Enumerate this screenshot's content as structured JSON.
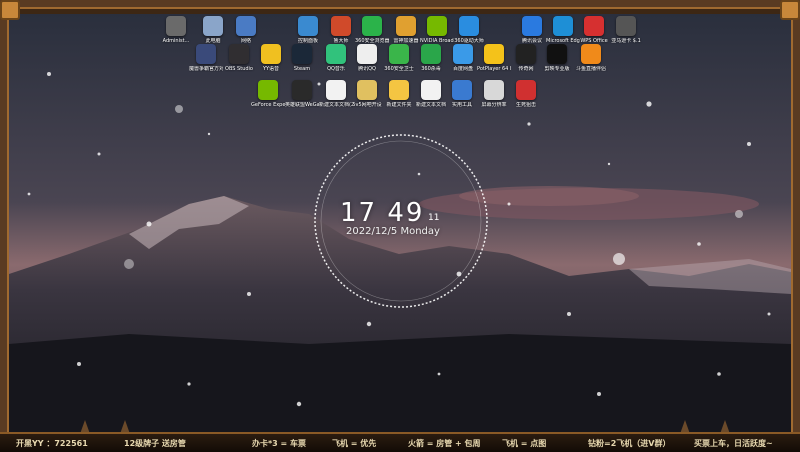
{
  "desktop": {
    "icons_row1": [
      {
        "label": "Administ...",
        "color": "#6a6a6a"
      },
      {
        "label": "此电脑",
        "color": "#8aa5c9"
      },
      {
        "label": "网络",
        "color": "#4a7bc4"
      },
      {
        "label": "控制面板",
        "color": "#3a8ad0"
      },
      {
        "label": "鲁大师",
        "color": "#d04a2a"
      },
      {
        "label": "360安全浏览器",
        "color": "#2bb34a"
      },
      {
        "label": "雷神加速器",
        "color": "#e0a030"
      },
      {
        "label": "NVIDIA Broadcast",
        "color": "#76b900"
      },
      {
        "label": "360驱动大师",
        "color": "#2a8de0"
      },
      {
        "label": "腾讯会议",
        "color": "#2a7ae0"
      },
      {
        "label": "Microsoft Edge",
        "color": "#1e8fd6"
      },
      {
        "label": "WPS Office",
        "color": "#d63030"
      },
      {
        "label": "亚马逊卡 $.1",
        "color": "#555555"
      }
    ],
    "icons_row2": [
      {
        "label": "魔兽争霸官方对战平台",
        "color": "#3a4a7a"
      },
      {
        "label": "OBS Studio",
        "color": "#302e31"
      },
      {
        "label": "YY语音",
        "color": "#f0c020"
      },
      {
        "label": "Steam",
        "color": "#1b2838"
      },
      {
        "label": "QQ音乐",
        "color": "#31c27c"
      },
      {
        "label": "腾讯QQ",
        "color": "#eeeeee"
      },
      {
        "label": "360安全卫士",
        "color": "#3ab54a"
      },
      {
        "label": "360杀毒",
        "color": "#2aa64a"
      },
      {
        "label": "百度网盘",
        "color": "#3a9ae8"
      },
      {
        "label": "PotPlayer 64 bit",
        "color": "#f4c21a"
      },
      {
        "label": "传奇网",
        "color": "#222222"
      },
      {
        "label": "剪映专业版",
        "color": "#111111"
      },
      {
        "label": "斗鱼直播伴侣",
        "color": "#f08a1a"
      }
    ],
    "icons_row3": [
      {
        "label": "GeForce Experience",
        "color": "#76b900"
      },
      {
        "label": "英雄联盟WeGame",
        "color": "#2a2a2a"
      },
      {
        "label": "新建文本文档(2)",
        "color": "#f2f2f2"
      },
      {
        "label": "5v5网吧开设",
        "color": "#e0c060"
      },
      {
        "label": "新建文件夹",
        "color": "#f4c542"
      },
      {
        "label": "新建文本文档",
        "color": "#f2f2f2"
      },
      {
        "label": "实用工具",
        "color": "#3a7ad0"
      },
      {
        "label": "屏幕分辨率",
        "color": "#d8d8d8"
      },
      {
        "label": "生死狙击",
        "color": "#d03030"
      }
    ]
  },
  "clock": {
    "time": "17  49",
    "seconds": "11",
    "date": "2022/12/5 Monday"
  },
  "taskbar": {
    "items": [
      "开黑YY ：722561",
      "12级牌子 送房管",
      "办卡*3 = 车票",
      "飞机 = 优先",
      "火箭 = 房管 + 包周",
      "飞机 = 点图",
      "钻粉=2飞机（进V群）",
      "买票上车，日活跃度~"
    ]
  },
  "colors": {
    "frame": "#5a3b22",
    "trim": "#a06a30",
    "ticker_text": "#e8d9b0"
  }
}
